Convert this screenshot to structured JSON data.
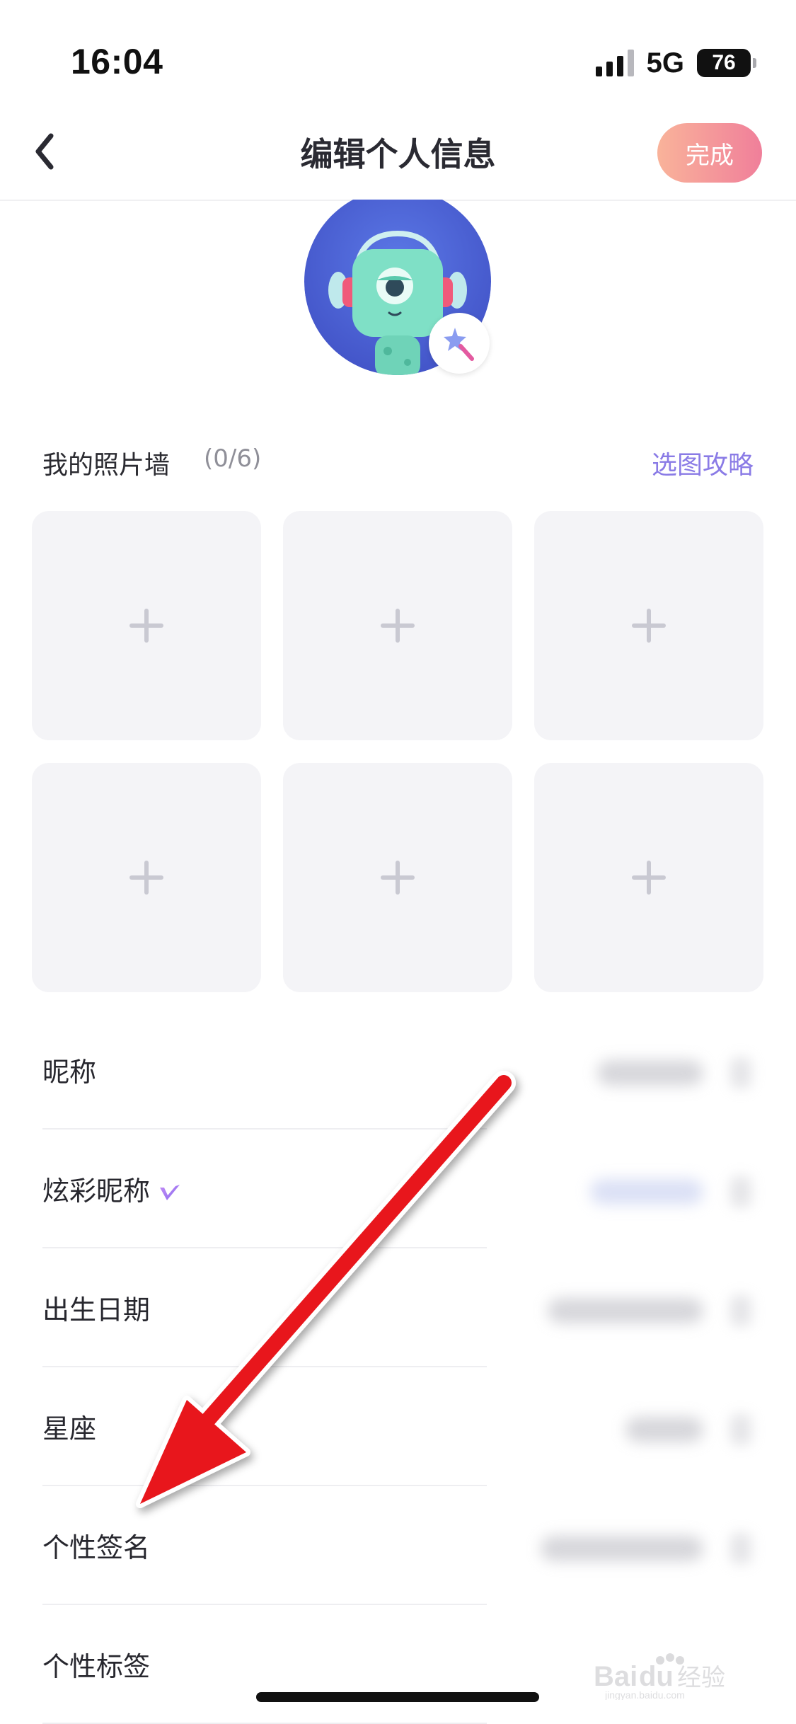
{
  "status_bar": {
    "time": "16:04",
    "network": "5G",
    "battery": "76"
  },
  "nav": {
    "title": "编辑个人信息",
    "done_label": "完成"
  },
  "photo_wall": {
    "title": "我的照片墙",
    "count": "(0/6)",
    "guide_link": "选图攻略",
    "slots": 6
  },
  "profile_rows": [
    {
      "label": "昵称"
    },
    {
      "label": "炫彩昵称",
      "badge": "vip-v-icon"
    },
    {
      "label": "出生日期"
    },
    {
      "label": "星座"
    },
    {
      "label": "个性签名"
    },
    {
      "label": "个性标签"
    }
  ],
  "annotation": {
    "type": "red-arrow",
    "color": "#e8141b"
  },
  "colors": {
    "accent_purple": "#8a7be6",
    "done_gradient_start": "#f9b39a",
    "done_gradient_end": "#f07f9a",
    "avatar_bg": "#4a63d6"
  },
  "icons": {
    "back": "chevron-left-icon",
    "add_photo": "plus-icon",
    "avatar_badge": "magic-wand-icon"
  }
}
